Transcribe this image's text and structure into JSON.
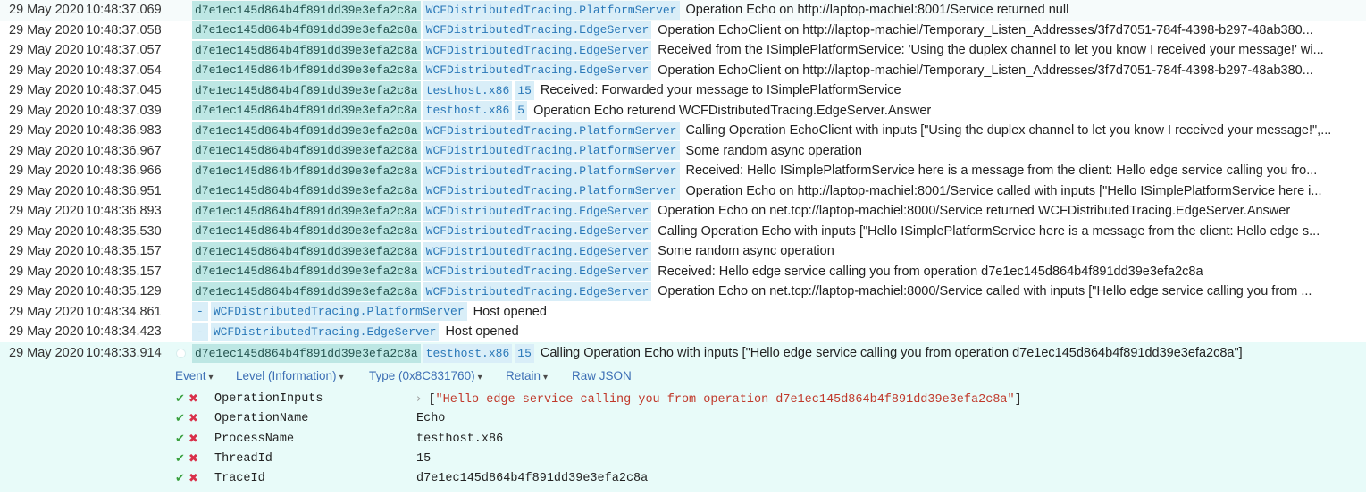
{
  "events": [
    {
      "date": "29 May 2020",
      "time": "10:48:37.069",
      "trace": "d7e1ec145d864b4f891dd39e3efa2c8a",
      "source": "WCFDistributedTracing.PlatformServer",
      "thread": "",
      "message": "Operation Echo on http://laptop-machiel:8001/Service returned null"
    },
    {
      "date": "29 May 2020",
      "time": "10:48:37.058",
      "trace": "d7e1ec145d864b4f891dd39e3efa2c8a",
      "source": "WCFDistributedTracing.EdgeServer",
      "thread": "",
      "message": "Operation EchoClient on http://laptop-machiel/Temporary_Listen_Addresses/3f7d7051-784f-4398-b297-48ab380..."
    },
    {
      "date": "29 May 2020",
      "time": "10:48:37.057",
      "trace": "d7e1ec145d864b4f891dd39e3efa2c8a",
      "source": "WCFDistributedTracing.EdgeServer",
      "thread": "",
      "message": "Received from the ISimplePlatformService: 'Using the duplex channel to let you know I received your message!' wi..."
    },
    {
      "date": "29 May 2020",
      "time": "10:48:37.054",
      "trace": "d7e1ec145d864b4f891dd39e3efa2c8a",
      "source": "WCFDistributedTracing.EdgeServer",
      "thread": "",
      "message": "Operation EchoClient on http://laptop-machiel/Temporary_Listen_Addresses/3f7d7051-784f-4398-b297-48ab380..."
    },
    {
      "date": "29 May 2020",
      "time": "10:48:37.045",
      "trace": "d7e1ec145d864b4f891dd39e3efa2c8a",
      "source": "testhost.x86",
      "thread": "15",
      "message": "Received: Forwarded your message to ISimplePlatformService"
    },
    {
      "date": "29 May 2020",
      "time": "10:48:37.039",
      "trace": "d7e1ec145d864b4f891dd39e3efa2c8a",
      "source": "testhost.x86",
      "thread": "5",
      "message": "Operation Echo returend WCFDistributedTracing.EdgeServer.Answer"
    },
    {
      "date": "29 May 2020",
      "time": "10:48:36.983",
      "trace": "d7e1ec145d864b4f891dd39e3efa2c8a",
      "source": "WCFDistributedTracing.PlatformServer",
      "thread": "",
      "message": "Calling Operation EchoClient with inputs [\"Using the duplex channel to let you know I received your message!\",..."
    },
    {
      "date": "29 May 2020",
      "time": "10:48:36.967",
      "trace": "d7e1ec145d864b4f891dd39e3efa2c8a",
      "source": "WCFDistributedTracing.PlatformServer",
      "thread": "",
      "message": "Some random async operation"
    },
    {
      "date": "29 May 2020",
      "time": "10:48:36.966",
      "trace": "d7e1ec145d864b4f891dd39e3efa2c8a",
      "source": "WCFDistributedTracing.PlatformServer",
      "thread": "",
      "message": "Received: Hello ISimplePlatformService here is a message from the client: Hello edge service calling you fro..."
    },
    {
      "date": "29 May 2020",
      "time": "10:48:36.951",
      "trace": "d7e1ec145d864b4f891dd39e3efa2c8a",
      "source": "WCFDistributedTracing.PlatformServer",
      "thread": "",
      "message": "Operation Echo on http://laptop-machiel:8001/Service called with inputs [\"Hello ISimplePlatformService here i..."
    },
    {
      "date": "29 May 2020",
      "time": "10:48:36.893",
      "trace": "d7e1ec145d864b4f891dd39e3efa2c8a",
      "source": "WCFDistributedTracing.EdgeServer",
      "thread": "",
      "message": "Operation Echo on net.tcp://laptop-machiel:8000/Service returned WCFDistributedTracing.EdgeServer.Answer"
    },
    {
      "date": "29 May 2020",
      "time": "10:48:35.530",
      "trace": "d7e1ec145d864b4f891dd39e3efa2c8a",
      "source": "WCFDistributedTracing.EdgeServer",
      "thread": "",
      "message": "Calling Operation Echo with inputs [\"Hello ISimplePlatformService here is a message from the client: Hello edge s..."
    },
    {
      "date": "29 May 2020",
      "time": "10:48:35.157",
      "trace": "d7e1ec145d864b4f891dd39e3efa2c8a",
      "source": "WCFDistributedTracing.EdgeServer",
      "thread": "",
      "message": "Some random async operation"
    },
    {
      "date": "29 May 2020",
      "time": "10:48:35.157",
      "trace": "d7e1ec145d864b4f891dd39e3efa2c8a",
      "source": "WCFDistributedTracing.EdgeServer",
      "thread": "",
      "message": "Received: Hello edge service calling you from operation d7e1ec145d864b4f891dd39e3efa2c8a"
    },
    {
      "date": "29 May 2020",
      "time": "10:48:35.129",
      "trace": "d7e1ec145d864b4f891dd39e3efa2c8a",
      "source": "WCFDistributedTracing.EdgeServer",
      "thread": "",
      "message": "Operation Echo on net.tcp://laptop-machiel:8000/Service called with inputs [\"Hello edge service calling you from ..."
    },
    {
      "date": "29 May 2020",
      "time": "10:48:34.861",
      "trace": "-",
      "source": "WCFDistributedTracing.PlatformServer",
      "thread": "",
      "message": "Host opened"
    },
    {
      "date": "29 May 2020",
      "time": "10:48:34.423",
      "trace": "-",
      "source": "WCFDistributedTracing.EdgeServer",
      "thread": "",
      "message": "Host opened"
    }
  ],
  "selected": {
    "date": "29 May 2020",
    "time": "10:48:33.914",
    "trace": "d7e1ec145d864b4f891dd39e3efa2c8a",
    "source": "testhost.x86",
    "thread": "15",
    "message": "Calling Operation Echo with inputs [\"Hello edge service calling you from operation d7e1ec145d864b4f891dd39e3efa2c8a\"]",
    "menu": {
      "event_label": "Event",
      "level_label": "Level (Information)",
      "type_label": "Type (0x8C831760)",
      "retain_label": "Retain",
      "raw_json_label": "Raw JSON"
    },
    "properties": [
      {
        "name": "OperationInputs",
        "value_prefix": "[",
        "value_string": "\"Hello edge service calling you from operation d7e1ec145d864b4f891dd39e3efa2c8a\"",
        "value_suffix": "]",
        "expandable": true
      },
      {
        "name": "OperationName",
        "value": "Echo"
      },
      {
        "name": "ProcessName",
        "value": "testhost.x86"
      },
      {
        "name": "ThreadId",
        "value": "15"
      },
      {
        "name": "TraceId",
        "value": "d7e1ec145d864b4f891dd39e3efa2c8a"
      }
    ]
  },
  "icons": {
    "chevron": "▾",
    "check": "✔",
    "cross": "✖",
    "expander": "›"
  },
  "colors": {
    "trace_bg": "#bde7e4",
    "source_bg": "#d9eef8",
    "selected_bg": "#e8fbf9",
    "link": "#3d6fb5",
    "check": "#3aa040",
    "cross": "#d9304a",
    "json_string": "#c0392b"
  }
}
